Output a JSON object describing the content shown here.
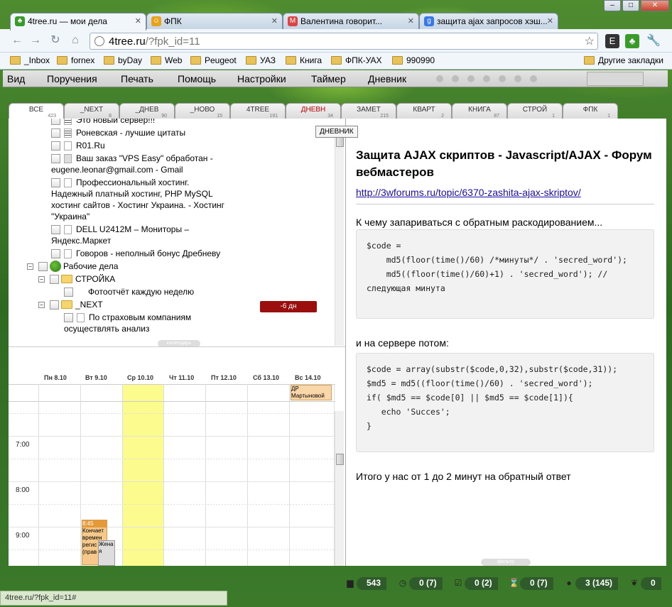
{
  "browser": {
    "tabs": [
      {
        "label": "4tree.ru — мои дела",
        "icon": "tree"
      },
      {
        "label": "ФПК",
        "icon": "smiley"
      },
      {
        "label": "Валентина говорит...",
        "icon": "gmail"
      },
      {
        "label": "защита ajax запросов хэш...",
        "icon": "google"
      }
    ],
    "url_host": "4tree.ru",
    "url_path": "/?fpk_id=11",
    "bookmarks": [
      "_Inbox",
      "fornex",
      "byDay",
      "Web",
      "Peugeot",
      "УАЗ",
      "Книга",
      "ФПК-УАХ",
      "990990"
    ],
    "other_bookmarks": "Другие закладки",
    "status_url": "4tree.ru/?fpk_id=11#"
  },
  "menu": [
    "Вид",
    "Поручения",
    "Печать",
    "Помощь",
    "Настройки",
    "Таймер",
    "Дневник"
  ],
  "tabs": [
    {
      "label": "ВСЕ",
      "count": "423"
    },
    {
      "label": "_NEXT",
      "count": "8"
    },
    {
      "label": "_ДНЕВ",
      "count": "90"
    },
    {
      "label": "_НОВО",
      "count": "15"
    },
    {
      "label": "4TREE",
      "count": "191"
    },
    {
      "label": "ДНЕВН",
      "count": "34"
    },
    {
      "label": "ЗАМЕТ",
      "count": "215"
    },
    {
      "label": "КВАРТ",
      "count": "2"
    },
    {
      "label": "КНИГА",
      "count": "87"
    },
    {
      "label": "СТРОЙ",
      "count": "1"
    },
    {
      "label": "ФПК",
      "count": "1"
    }
  ],
  "tooltip": "ДНЕВНИК",
  "tree": {
    "items": [
      "Это новый сервер!!!",
      "Роневская - лучшие цитаты",
      "R01.Ru",
      "Ваш заказ \"VPS Easy\" обработан -",
      "eugene.leonar@gmail.com - Gmail",
      "Профессиональный хостинг.",
      "Надежный платный хостинг, PHP MySQL",
      "хостинг сайтов - Хостинг Украина. - Хостинг",
      "\"Украина\"",
      "DELL U2412M – Мониторы –",
      "Яндекс.Маркет",
      "Говоров - неполный бонус Дребневу",
      "Рабочие дела",
      "СТРОЙКА",
      "Фотоотчёт каждую неделю",
      "_NEXT",
      "По страховым компаниям",
      "осуществлять анализ"
    ],
    "badge": "-6 дн",
    "calendar_pill": "календарь"
  },
  "calendar": {
    "days": [
      "Пн 8.10",
      "Вт 9.10",
      "Ср 10.10",
      "Чт 11.10",
      "Пт 12.10",
      "Сб 13.10",
      "Вс 14.10"
    ],
    "allday_event": "ДР Мартыновой",
    "times": [
      "7:00",
      "8:00",
      "9:00"
    ],
    "event1_time": "8:45",
    "event1_text": "Кончает времен регис (прав",
    "event2_text": "Жена я"
  },
  "note": {
    "title": "Защита AJAX скриптов - Javascript/AJAX - Форум вебмастеров",
    "link": "http://3wforums.ru/topic/6370-zashita-ajax-skriptov/",
    "p1": "К чему запариваться с обратным раскодированием...",
    "code1": "$code =\n    md5(floor(time()/60) /*минуты*/ . 'secred_word');\n    md5((floor(time()/60)+1) . 'secred_word'); // следующая минута",
    "p2": "и на сервере потом:",
    "code2": "$code = array(substr($code,0,32),substr($code,31));\n$md5 = md5((floor(time()/60) . 'secred_word');\nif( $md5 == $code[0] || $md5 == $code[1]){\n   echo 'Succes';\n}",
    "p3": "Итого у нас от 1 до 2 минут на обратный ответ",
    "filter_pill": "фильтр"
  },
  "status": {
    "total": "543",
    "timer": "0 (7)",
    "done": "0 (2)",
    "wait": "0 (7)",
    "dot": "3 (145)",
    "leaf": "0"
  }
}
